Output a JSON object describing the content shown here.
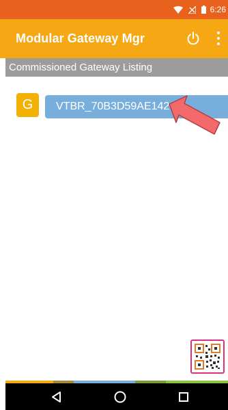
{
  "status_bar": {
    "time": "6:26",
    "icons": [
      "wifi-icon",
      "no-signal-icon",
      "battery-icon"
    ]
  },
  "app_bar": {
    "title": "Modular Gateway Mgr",
    "power_icon": "power-icon",
    "menu_icon": "overflow-menu-icon"
  },
  "section": {
    "title": "Commissioned Gateway Listing"
  },
  "gateways": [
    {
      "badge": "G",
      "name": "VTBR_70B3D59AE142"
    }
  ],
  "colors": {
    "status_bar": "#e8621e",
    "app_bar": "#f5a814",
    "badge": "#f3b005",
    "gateway_item": "#77aedb",
    "section_header": "#9c9c9c",
    "qr_border": "#d8337a"
  },
  "fab": {
    "icon": "qr-code-icon"
  },
  "nav_bar": {
    "icons": [
      "back-icon",
      "home-icon",
      "recent-apps-icon"
    ]
  }
}
